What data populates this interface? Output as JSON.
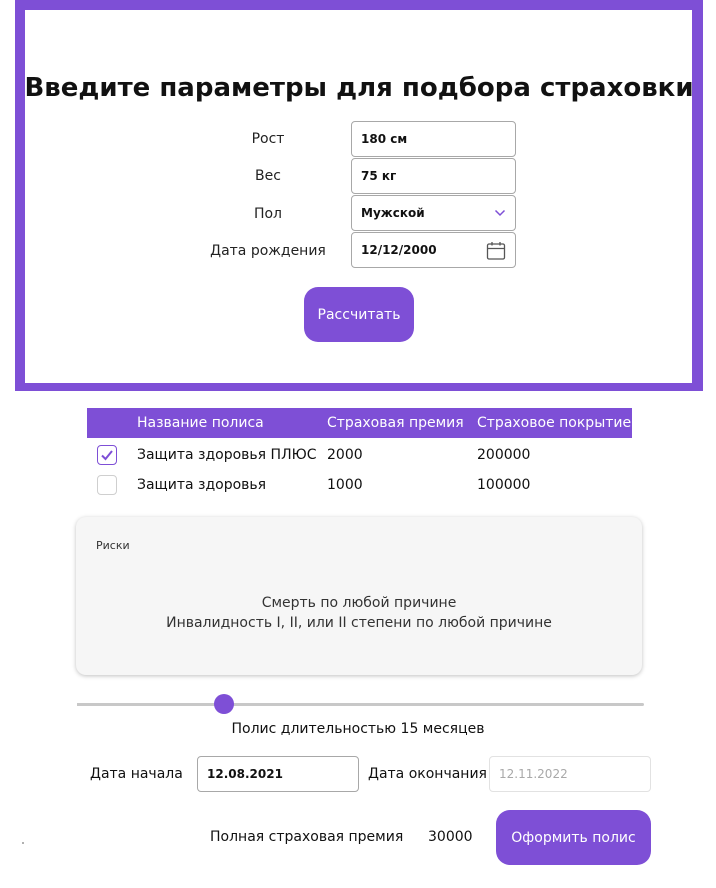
{
  "form": {
    "title": "Введите параметры для подбора страховки",
    "height_label": "Рост",
    "height_value": "180 см",
    "weight_label": "Вес",
    "weight_value": "75 кг",
    "gender_label": "Пол",
    "gender_value": "Мужской",
    "birth_label": "Дата рождения",
    "birth_value": "12/12/2000",
    "calc_button": "Рассчитать"
  },
  "grid": {
    "headers": [
      "Название полиса",
      "Страховая премия",
      "Страховое покрытие"
    ],
    "rows": [
      {
        "checked": true,
        "name": "Защита здоровья ПЛЮС",
        "premium": "2000",
        "coverage": "200000"
      },
      {
        "checked": false,
        "name": "Защита здоровья",
        "premium": "1000",
        "coverage": "100000"
      }
    ]
  },
  "risks": {
    "title": "Риски",
    "items": [
      "Смерть по любой причине",
      "Инвалидность I, II, или II степени по любой причине"
    ]
  },
  "duration": {
    "slider_fraction": 0.26,
    "label": "Полис длительностью 15 месяцев"
  },
  "dates": {
    "start_label": "Дата начала",
    "start_value": "12.08.2021",
    "end_label": "Дата окончания",
    "end_value": "12.11.2022"
  },
  "summary": {
    "total_label": "Полная страховая премия",
    "total_value": "30000",
    "issue_button": "Оформить полис"
  },
  "colors": {
    "accent": "#7e4fd6"
  },
  "icons": {
    "gender_dropdown": "chevron-down-icon",
    "birth_picker": "calendar-icon"
  }
}
